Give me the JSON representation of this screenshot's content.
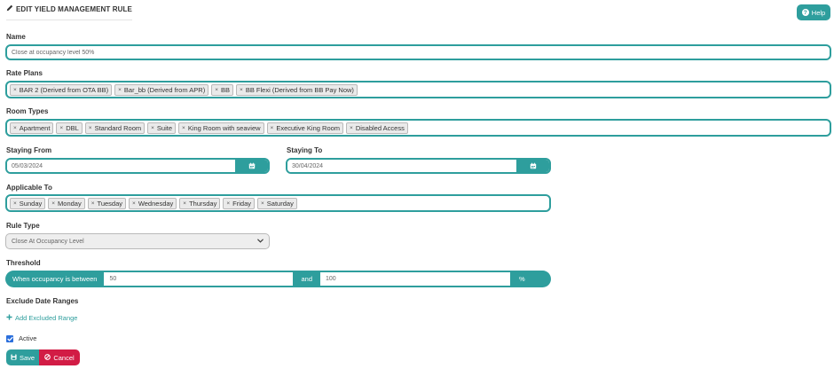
{
  "header": {
    "title": "EDIT YIELD MANAGEMENT RULE",
    "title_icon": "pencil-icon",
    "help_label": "Help",
    "help_icon": "question-circle-icon"
  },
  "form": {
    "name": {
      "label": "Name",
      "value": "Close at occupancy level 50%"
    },
    "rate_plans": {
      "label": "Rate Plans",
      "tags": [
        "BAR 2 (Derived from OTA BB)",
        "Bar_bb (Derived from APR)",
        "BB",
        "BB Flexi (Derived from BB Pay Now)"
      ]
    },
    "room_types": {
      "label": "Room Types",
      "tags": [
        "Apartment",
        "DBL",
        "Standard Room",
        "Suite",
        "King Room with seaview",
        "Executive King Room",
        "Disabled Access"
      ]
    },
    "staying_from": {
      "label": "Staying From",
      "value": "05/03/2024"
    },
    "staying_to": {
      "label": "Staying To",
      "value": "30/04/2024"
    },
    "applicable_to": {
      "label": "Applicable To",
      "tags": [
        "Sunday",
        "Monday",
        "Tuesday",
        "Wednesday",
        "Thursday",
        "Friday",
        "Saturday"
      ]
    },
    "rule_type": {
      "label": "Rule Type",
      "selected": "Close At Occupancy Level"
    },
    "threshold": {
      "label": "Threshold",
      "prefix": "When occupancy is between",
      "min": "50",
      "middle": "and",
      "max": "100",
      "suffix": "%"
    },
    "exclude_date_ranges": {
      "label": "Exclude Date Ranges",
      "add_label": "Add Excluded Range"
    },
    "active": {
      "label": "Active",
      "checked": true
    }
  },
  "actions": {
    "save_label": "Save",
    "cancel_label": "Cancel"
  },
  "colors": {
    "accent": "#2e9e9d",
    "danger": "#d21c45",
    "checkbox": "#2b6fdc"
  },
  "tag_remove_glyph": "×"
}
